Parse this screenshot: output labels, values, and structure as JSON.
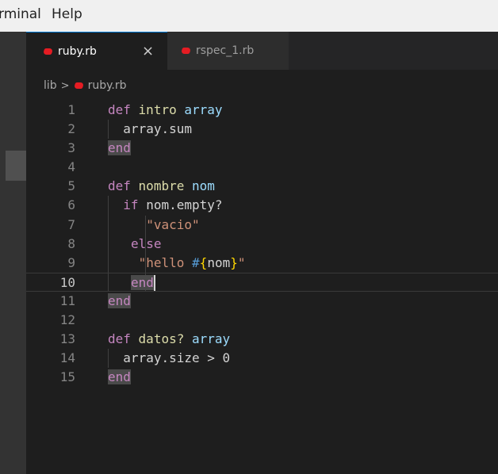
{
  "menubar": {
    "items": [
      "rminal",
      "Help"
    ]
  },
  "tabs": [
    {
      "label": "ruby.rb",
      "active": true,
      "close": "×"
    },
    {
      "label": "rspec_1.rb",
      "active": false
    }
  ],
  "breadcrumb": {
    "folder": "lib",
    "separator": ">",
    "file": "ruby.rb"
  },
  "editor": {
    "current_line": 10,
    "lines": [
      {
        "n": "1",
        "tokens": [
          [
            "def",
            "kw2"
          ],
          [
            " ",
            ""
          ],
          [
            "intro",
            "fn"
          ],
          [
            " ",
            ""
          ],
          [
            "array",
            "var"
          ]
        ]
      },
      {
        "n": "2",
        "tokens": [
          [
            "array.sum",
            ""
          ]
        ]
      },
      {
        "n": "3",
        "tokens": [
          [
            "end",
            "kw2"
          ]
        ]
      },
      {
        "n": "4",
        "tokens": []
      },
      {
        "n": "5",
        "tokens": [
          [
            "def",
            "kw2"
          ],
          [
            " ",
            ""
          ],
          [
            "nombre",
            "fn"
          ],
          [
            " ",
            ""
          ],
          [
            "nom",
            "var"
          ]
        ]
      },
      {
        "n": "6",
        "tokens": [
          [
            "if",
            "kw2"
          ],
          [
            " nom.empty?",
            ""
          ]
        ]
      },
      {
        "n": "7",
        "tokens": [
          [
            "\"vacio\"",
            "str"
          ]
        ]
      },
      {
        "n": "8",
        "tokens": [
          [
            "else",
            "kw2"
          ]
        ]
      },
      {
        "n": "9",
        "tokens": [
          [
            "\"hello ",
            "str"
          ],
          [
            "#",
            "interp"
          ],
          [
            "{",
            "brace"
          ],
          [
            "nom",
            ""
          ],
          [
            "}",
            "brace"
          ],
          [
            "\"",
            "str"
          ]
        ]
      },
      {
        "n": "10",
        "tokens": [
          [
            "end",
            "kw2"
          ]
        ]
      },
      {
        "n": "11",
        "tokens": [
          [
            "end",
            "kw2"
          ]
        ]
      },
      {
        "n": "12",
        "tokens": []
      },
      {
        "n": "13",
        "tokens": [
          [
            "def",
            "kw2"
          ],
          [
            " ",
            ""
          ],
          [
            "datos?",
            "fn"
          ],
          [
            " ",
            ""
          ],
          [
            "array",
            "var"
          ]
        ]
      },
      {
        "n": "14",
        "tokens": [
          [
            "array.size > 0",
            ""
          ]
        ]
      },
      {
        "n": "15",
        "tokens": [
          [
            "end",
            "kw2"
          ]
        ]
      }
    ]
  },
  "colors": {
    "accent": "#0078d4",
    "ruby_icon": "#e51c23",
    "keyword": "#c586c0",
    "function": "#dcdcaa",
    "variable": "#9cdcfe",
    "string": "#ce9178"
  }
}
